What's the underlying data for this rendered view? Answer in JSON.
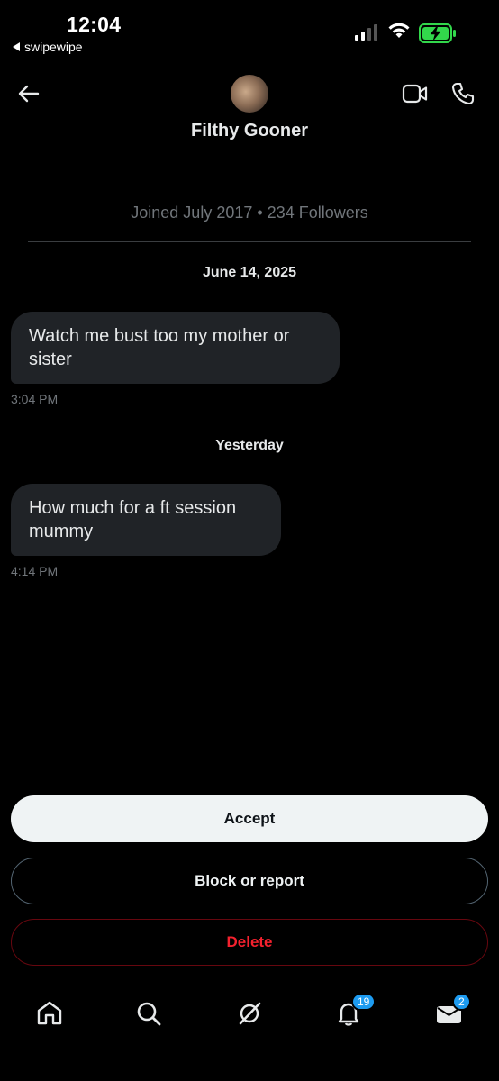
{
  "status": {
    "time": "12:04",
    "back_app": "swipewipe"
  },
  "header": {
    "name": "Filthy Gooner",
    "profile_info": "Joined July 2017 • 234 Followers"
  },
  "messages": [
    {
      "date": "June 14, 2025",
      "text": "Watch me bust too my mother or sister",
      "time": "3:04 PM"
    },
    {
      "date": "Yesterday",
      "text": "How much for a ft session mummy",
      "time": "4:14 PM"
    }
  ],
  "actions": {
    "accept": "Accept",
    "block": "Block or report",
    "delete": "Delete"
  },
  "tabbar": {
    "notifications_count": "19",
    "messages_count": "2"
  },
  "colors": {
    "accent": "#1d9bf0",
    "danger": "#f4212e",
    "bubble": "#202327",
    "muted": "#71767b"
  }
}
